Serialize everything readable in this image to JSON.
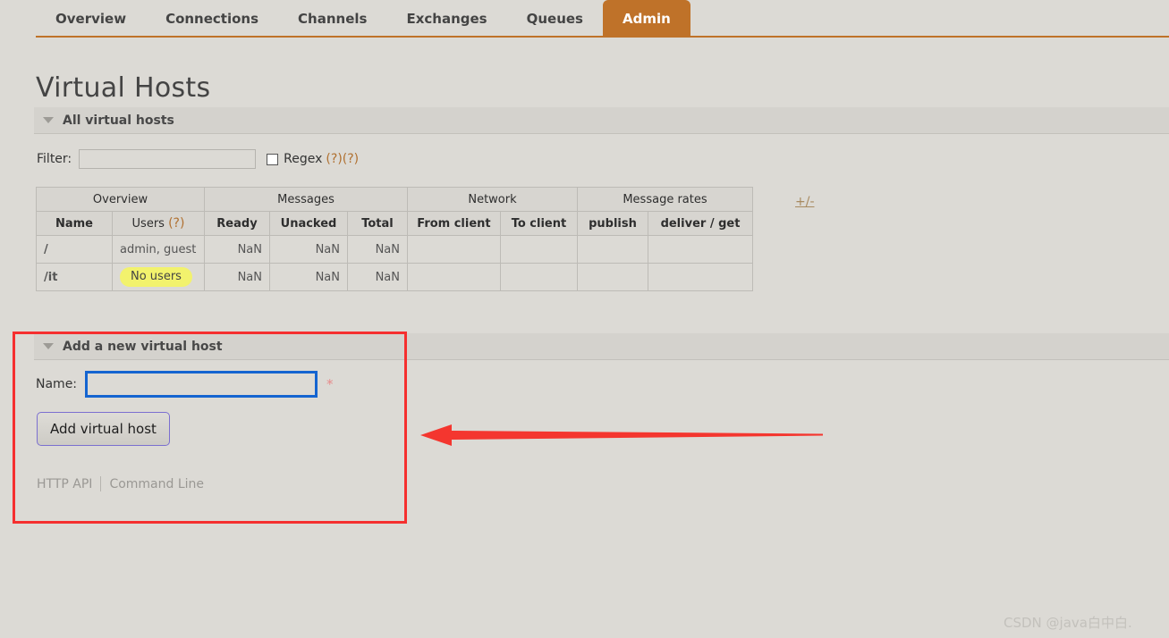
{
  "nav": {
    "items": [
      {
        "label": "Overview",
        "active": false
      },
      {
        "label": "Connections",
        "active": false
      },
      {
        "label": "Channels",
        "active": false
      },
      {
        "label": "Exchanges",
        "active": false
      },
      {
        "label": "Queues",
        "active": false
      },
      {
        "label": "Admin",
        "active": true
      }
    ],
    "accent_color": "#bf7229"
  },
  "page": {
    "title": "Virtual Hosts"
  },
  "sections": {
    "all_vhosts": {
      "label": "All virtual hosts"
    },
    "add_vhost": {
      "label": "Add a new virtual host"
    }
  },
  "filter": {
    "label": "Filter:",
    "value": "",
    "placeholder": "",
    "regex_label": "Regex",
    "regex_checked": false,
    "help1": "(?)",
    "help2": "(?)"
  },
  "table": {
    "group_headers": [
      {
        "label": "Overview",
        "span": 2
      },
      {
        "label": "Messages",
        "span": 3
      },
      {
        "label": "Network",
        "span": 2
      },
      {
        "label": "Message rates",
        "span": 2
      }
    ],
    "columns": [
      {
        "label": "Name",
        "bold": true
      },
      {
        "label": "Users",
        "bold": false,
        "help": "(?)"
      },
      {
        "label": "Ready",
        "bold": true
      },
      {
        "label": "Unacked",
        "bold": true
      },
      {
        "label": "Total",
        "bold": true
      },
      {
        "label": "From client",
        "bold": true
      },
      {
        "label": "To client",
        "bold": true
      },
      {
        "label": "publish",
        "bold": true
      },
      {
        "label": "deliver / get",
        "bold": true
      }
    ],
    "rows": [
      {
        "name": "/",
        "users": "admin, guest",
        "users_badge": false,
        "ready": "NaN",
        "unacked": "NaN",
        "total": "NaN",
        "from_client": "",
        "to_client": "",
        "publish": "",
        "deliver_get": ""
      },
      {
        "name": "/it",
        "users": "No users",
        "users_badge": true,
        "ready": "NaN",
        "unacked": "NaN",
        "total": "NaN",
        "from_client": "",
        "to_client": "",
        "publish": "",
        "deliver_get": ""
      }
    ],
    "column_toggle": "+/-",
    "badge_color": "#f2f26d"
  },
  "add_form": {
    "name_label": "Name:",
    "name_value": "",
    "name_placeholder": "",
    "required_marker": "*",
    "submit_label": "Add virtual host",
    "http_api_label": "HTTP API",
    "command_line_label": "Command Line"
  },
  "annotations": {
    "highlight_color": "#f52f2f",
    "arrow_color": "#f4362f"
  },
  "watermark": {
    "text": "CSDN @java白中白."
  }
}
